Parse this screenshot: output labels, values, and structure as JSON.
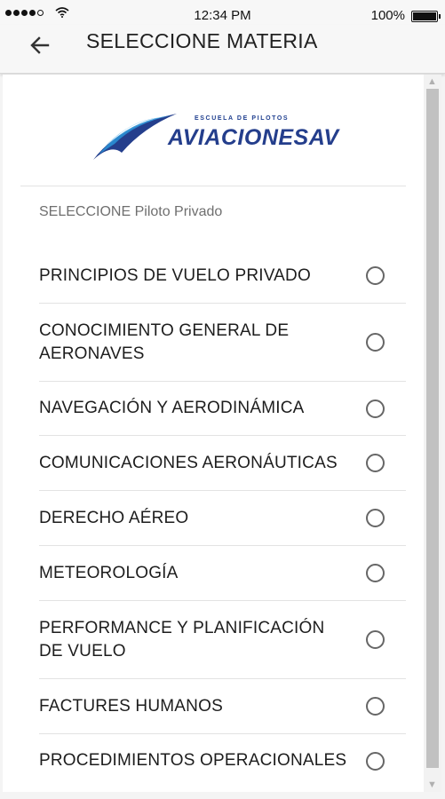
{
  "status_bar": {
    "time": "12:34 PM",
    "battery": "100%"
  },
  "app_bar": {
    "title": "SELECCIONE MATERIA"
  },
  "logo": {
    "tagline": "ESCUELA DE PILOTOS",
    "name": "AVIACIONESAV"
  },
  "subtitle": "SELECCIONE Piloto Privado",
  "subjects": [
    {
      "label": "PRINCIPIOS DE VUELO PRIVADO"
    },
    {
      "label": "CONOCIMIENTO GENERAL DE AERONAVES"
    },
    {
      "label": "NAVEGACIÓN Y AERODINÁMICA"
    },
    {
      "label": "COMUNICACIONES AERONÁUTICAS"
    },
    {
      "label": "DERECHO AÉREO"
    },
    {
      "label": "METEOROLOGÍA"
    },
    {
      "label": "PERFORMANCE Y PLANIFICACIÓN DE VUELO"
    },
    {
      "label": "FACTURES HUMANOS"
    },
    {
      "label": "PROCEDIMIENTOS OPERACIONALES"
    }
  ],
  "colors": {
    "logo_blue": "#243e8c",
    "logo_light_blue": "#2a8fd4"
  },
  "icons": [
    "back-arrow-icon",
    "wifi-icon",
    "battery-icon",
    "radio-unchecked-icon"
  ]
}
